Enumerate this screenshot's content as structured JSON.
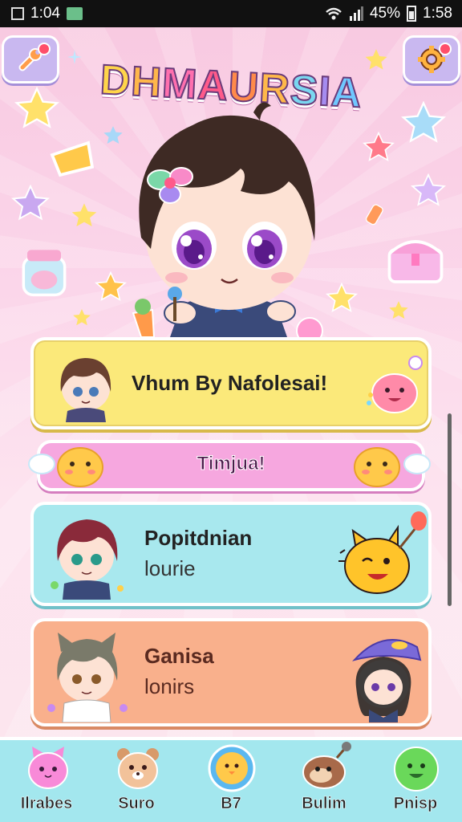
{
  "status_bar": {
    "time_left": "1:04",
    "battery_percent": "45%",
    "time_right": "1:58"
  },
  "header": {
    "logo_text": "DHMAURSIA",
    "logo_letters": [
      {
        "ch": "D",
        "color": "#ffd54a"
      },
      {
        "ch": "H",
        "color": "#ffb74a"
      },
      {
        "ch": "M",
        "color": "#ff6fae"
      },
      {
        "ch": "A",
        "color": "#ff5a8a"
      },
      {
        "ch": "U",
        "color": "#ff8a4a"
      },
      {
        "ch": "R",
        "color": "#ffb84a"
      },
      {
        "ch": "S",
        "color": "#7ad7f0"
      },
      {
        "ch": "I",
        "color": "#a58cf0"
      },
      {
        "ch": "A",
        "color": "#6fc8ff"
      }
    ]
  },
  "cards": [
    {
      "title": "Vhum By Nafolesai!",
      "color": "#fbe97a"
    },
    {
      "title": "Timjua!",
      "color": "#f6a7df"
    },
    {
      "title": "Popitdnian",
      "subtitle": "lourie",
      "color": "#a8e8ee"
    },
    {
      "title": "Ganisa",
      "subtitle": "lonirs",
      "color": "#f9b08c"
    }
  ],
  "nav": [
    {
      "label": "Ilrabes",
      "icon": "pink-cat-icon"
    },
    {
      "label": "Suro",
      "icon": "bear-icon"
    },
    {
      "label": "B7",
      "icon": "chick-icon"
    },
    {
      "label": "Bulim",
      "icon": "otter-icon"
    },
    {
      "label": "Pnisp",
      "icon": "green-blob-icon"
    }
  ],
  "colors": {
    "accent_pink": "#f6a7df",
    "accent_cyan": "#a3e7ee",
    "accent_yellow": "#fbe97a",
    "accent_orange": "#f9b08c"
  }
}
